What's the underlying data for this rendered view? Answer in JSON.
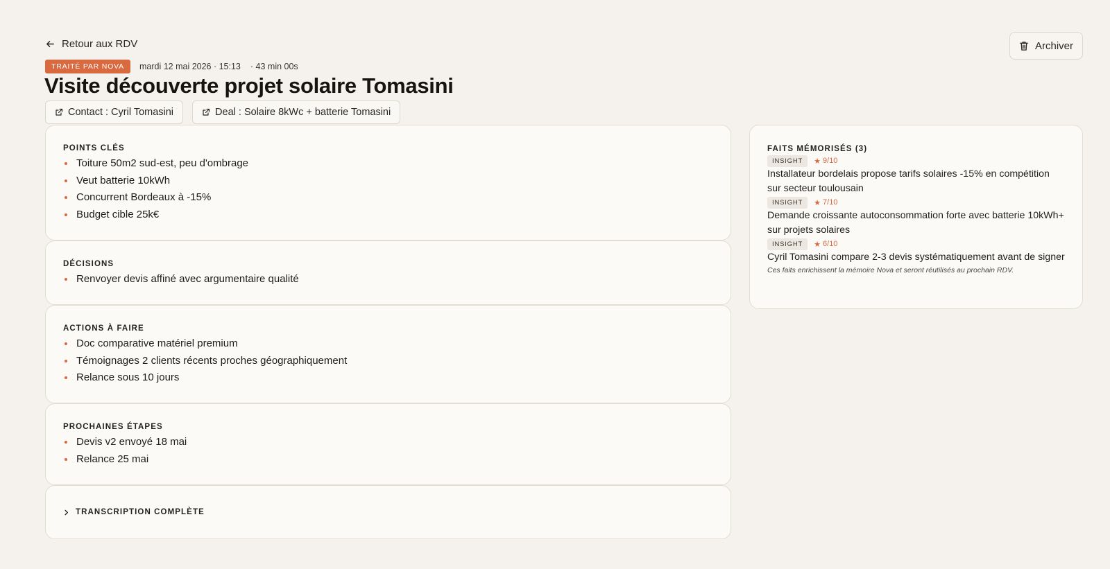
{
  "header": {
    "back_label": "Retour aux RDV",
    "archive_label": "Archiver",
    "status_badge": "TRAITÉ PAR NOVA",
    "datetime": "mardi 12 mai 2026 · 15:13",
    "duration": "· 43 min 00s",
    "title": "Visite découverte projet solaire Tomasini",
    "contact_link": "Contact : Cyril Tomasini",
    "deal_link": "Deal : Solaire 8kWc + batterie Tomasini"
  },
  "points_cles": {
    "heading": "POINTS CLÉS",
    "items": [
      "Toiture 50m2 sud-est, peu d'ombrage",
      "Veut batterie 10kWh",
      "Concurrent Bordeaux à -15%",
      "Budget cible 25k€"
    ]
  },
  "decisions": {
    "heading": "DÉCISIONS",
    "items": [
      "Renvoyer devis affiné avec argumentaire qualité"
    ]
  },
  "actions": {
    "heading": "ACTIONS À FAIRE",
    "items": [
      "Doc comparative matériel premium",
      "Témoignages 2 clients récents proches géographiquement",
      "Relance sous 10 jours"
    ]
  },
  "prochaines_etapes": {
    "heading": "PROCHAINES ÉTAPES",
    "items": [
      "Devis v2 envoyé 18 mai",
      "Relance 25 mai"
    ]
  },
  "transcript": {
    "heading": "TRANSCRIPTION COMPLÈTE"
  },
  "facts": {
    "heading": "FAITS MÉMORISÉS (3)",
    "items": [
      {
        "tag": "INSIGHT",
        "rating": "9/10",
        "text": "Installateur bordelais propose tarifs solaires -15% en compétition sur secteur toulousain"
      },
      {
        "tag": "INSIGHT",
        "rating": "7/10",
        "text": "Demande croissante autoconsommation forte avec batterie 10kWh+ sur projets solaires"
      },
      {
        "tag": "INSIGHT",
        "rating": "6/10",
        "text": "Cyril Tomasini compare 2-3 devis systématiquement avant de signer"
      }
    ],
    "note": "Ces faits enrichissent la mémoire Nova et seront réutilisés au prochain RDV."
  },
  "colors": {
    "accent": "#d9693f",
    "background": "#f5f1ec",
    "card": "#fbfaf7"
  },
  "icons": {
    "back": "arrow-left-icon",
    "archive": "trash-icon",
    "external": "external-link-icon",
    "expand": "chevron-right-icon",
    "star": "star-icon"
  }
}
